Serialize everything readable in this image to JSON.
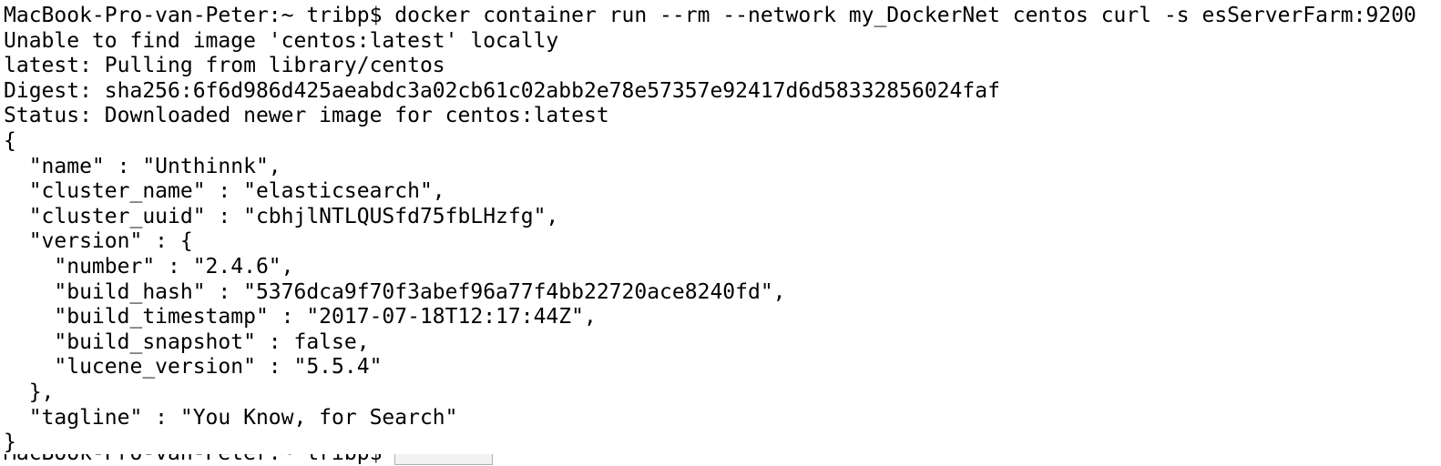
{
  "terminal": {
    "lines": [
      "MacBook-Pro-van-Peter:~ tribp$ docker container run --rm --network my_DockerNet centos curl -s esServerFarm:9200",
      "Unable to find image 'centos:latest' locally",
      "latest: Pulling from library/centos",
      "Digest: sha256:6f6d986d425aeabdc3a02cb61c02abb2e78e57357e92417d6d58332856024faf",
      "Status: Downloaded newer image for centos:latest",
      "{",
      "  \"name\" : \"Unthinnk\",",
      "  \"cluster_name\" : \"elasticsearch\",",
      "  \"cluster_uuid\" : \"cbhjlNTLQUSfd75fbLHzfg\",",
      "  \"version\" : {",
      "    \"number\" : \"2.4.6\",",
      "    \"build_hash\" : \"5376dca9f70f3abef96a77f4bb22720ace8240fd\",",
      "    \"build_timestamp\" : \"2017-07-18T12:17:44Z\",",
      "    \"build_snapshot\" : false,",
      "    \"lucene_version\" : \"5.5.4\"",
      "  },",
      "  \"tagline\" : \"You Know, for Search\"",
      "}"
    ],
    "partial_line": "MacBook-Pro-van-Peter:~ tribp$ "
  }
}
